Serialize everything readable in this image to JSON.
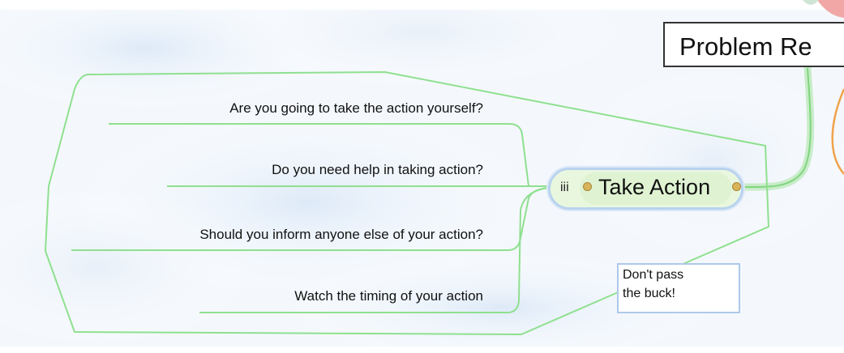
{
  "central_topic": {
    "label": "Problem Re"
  },
  "main_topic": {
    "number": "iii",
    "label": "Take Action"
  },
  "subtopics": [
    {
      "label": "Are you going to take the action yourself?"
    },
    {
      "label": "Do you need help in taking action?"
    },
    {
      "label": "Should you inform anyone else of your action?"
    },
    {
      "label": "Watch the timing of your action"
    }
  ],
  "callout": {
    "lines": [
      "Don't pass",
      "the buck!"
    ]
  },
  "colors": {
    "branch_green": "#8fe08f",
    "boundary_green": "#8fe08f",
    "pill_fill": "#e9f7df",
    "pill_border": "#b9d3ef",
    "callout_border": "#aec8ea",
    "connector_orange": "#f0a24a",
    "background_sky": "#e8f1fb"
  }
}
